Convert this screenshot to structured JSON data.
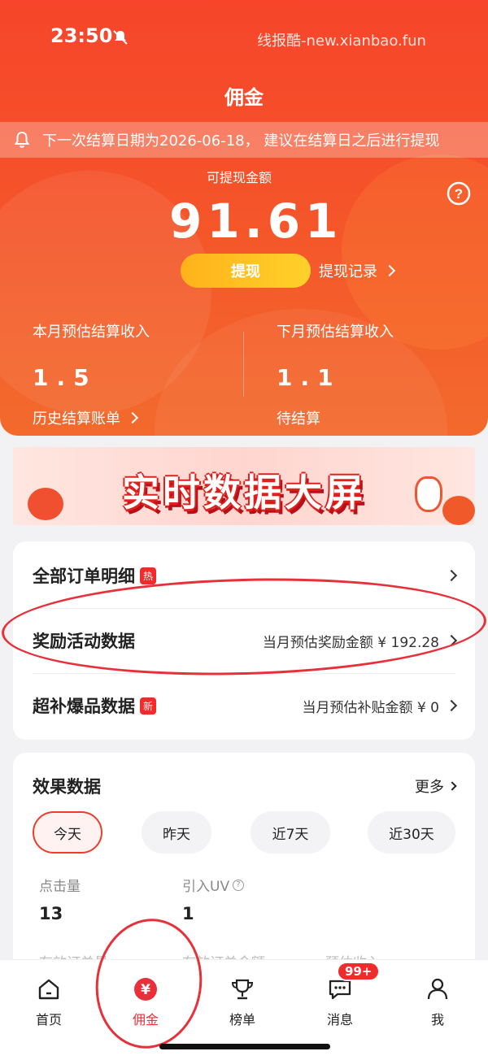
{
  "status_bar": {
    "time": "23:50",
    "carrier_text": "线报酷-new.xianbao.fun"
  },
  "header": {
    "title": "佣金",
    "notice": "下一次结算日期为2026-06-18， 建议在结算日之后进行提现",
    "withdrawable_label": "可提现金额",
    "withdrawable_amount": "91.61",
    "withdraw_button": "提现",
    "withdraw_records": "提现记录",
    "this_month_label": "本月预估结算收入",
    "this_month_value": "1.5",
    "next_month_label": "下月预估结算收入",
    "next_month_value": "1.1",
    "history_link": "历史结算账单",
    "pending_label": "待结算"
  },
  "banner": {
    "text": "实时数据大屏"
  },
  "order_card": {
    "rows": [
      {
        "title": "全部订单明细",
        "badge": "热",
        "right": ""
      },
      {
        "title": "奖励活动数据",
        "badge": "",
        "right": "当月预估奖励金额 ¥ 192.28"
      },
      {
        "title": "超补爆品数据",
        "badge": "新",
        "right": "当月预估补贴金额 ¥ 0"
      }
    ]
  },
  "performance": {
    "title": "效果数据",
    "more": "更多",
    "tabs": [
      "今天",
      "昨天",
      "近7天",
      "近30天"
    ],
    "active_tab": "今天",
    "metrics": [
      {
        "label": "点击量",
        "value": "13"
      },
      {
        "label": "引入UV",
        "value": "1"
      }
    ],
    "faded_labels": [
      "有效订单量",
      "有效订单金额",
      "预估收入"
    ]
  },
  "tabbar": {
    "items": [
      {
        "label": "首页",
        "icon": "home-icon"
      },
      {
        "label": "佣金",
        "icon": "yuan-icon"
      },
      {
        "label": "榜单",
        "icon": "trophy-icon"
      },
      {
        "label": "消息",
        "icon": "message-icon"
      },
      {
        "label": "我",
        "icon": "user-icon"
      }
    ],
    "active": "佣金",
    "message_badge": "99+"
  },
  "colors": {
    "primary": "#f5512a",
    "accent_red": "#e8303a",
    "button_yellow": "#ffc21e"
  }
}
